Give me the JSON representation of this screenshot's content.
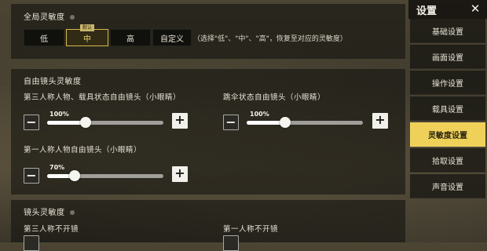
{
  "sidebar": {
    "title": "设置",
    "items": [
      {
        "label": "基础设置",
        "active": false
      },
      {
        "label": "画面设置",
        "active": false
      },
      {
        "label": "操作设置",
        "active": false
      },
      {
        "label": "载具设置",
        "active": false
      },
      {
        "label": "灵敏度设置",
        "active": true
      },
      {
        "label": "拾取设置",
        "active": false
      },
      {
        "label": "声音设置",
        "active": false
      }
    ]
  },
  "global": {
    "title": "全局灵敏度",
    "presets": [
      {
        "label": "低",
        "active": false
      },
      {
        "label": "中",
        "active": true,
        "tag": "默认"
      },
      {
        "label": "高",
        "active": false
      },
      {
        "label": "自定义",
        "active": false
      }
    ],
    "note": "（选择\"低\"、\"中\"、\"高\"，恢复至对应的灵敏度）"
  },
  "free_camera": {
    "title": "自由镜头灵敏度",
    "third_person": {
      "label": "第三人称人物、载具状态自由镜头（小眼睛）",
      "value_text": "100%",
      "value": 100
    },
    "parachute": {
      "label": "跳伞状态自由镜头（小眼睛）",
      "value_text": "100%",
      "value": 100
    },
    "first_person": {
      "label": "第一人称人物自由镜头（小眼睛）",
      "value_text": "70%",
      "value": 70
    }
  },
  "camera": {
    "title": "镜头灵敏度",
    "third_person_no_scope": "第三人称不开镜",
    "first_person_no_scope": "第一人称不开镜"
  },
  "slider": {
    "min": 0,
    "max": 300
  },
  "icons": {
    "minus": "−",
    "plus": "+",
    "close": "✕"
  }
}
